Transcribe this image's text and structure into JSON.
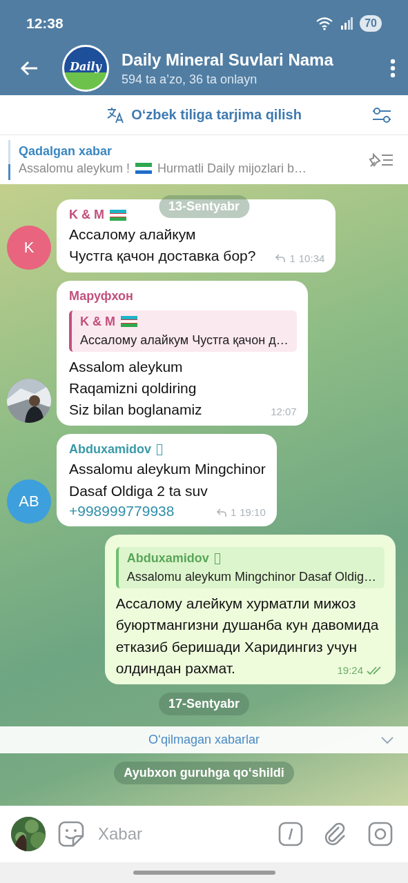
{
  "status_bar": {
    "time": "12:38",
    "battery": "70"
  },
  "header": {
    "title": "Daily Mineral Suvlari Nama",
    "subtitle": "594 ta a’zo, 36 ta onlayn",
    "logo_text": "Daily"
  },
  "translate_bar": {
    "label": "O‘zbek tiliga tarjima qilish"
  },
  "pinned": {
    "title": "Qadalgan xabar",
    "text_before": "Assalomu aleykum !",
    "text_after": "Hurmatli Daily mijozlari b…"
  },
  "floating_date": "13-Sentyabr",
  "chat": [
    {
      "kind": "incoming",
      "avatar": {
        "kind": "initials",
        "text": "K",
        "color": "#e8647f"
      },
      "sender": "K & M",
      "color": "#c2507c",
      "badge": {
        "kind": "flag"
      },
      "lines": [
        "Ассалому алайкум",
        "Чустга қачон доставка бор?"
      ],
      "replies": "1",
      "time": "10:34"
    },
    {
      "kind": "incoming",
      "avatar": {
        "kind": "picture"
      },
      "sender": "Маруфхон",
      "color": "#c2507c",
      "reply": {
        "sender": "K & M",
        "badge": {
          "kind": "flag"
        },
        "text": "Ассалому алайкум  Чустга қачон д…"
      },
      "lines": [
        "Assalom aleykum",
        "Raqamizni qoldiring",
        "Siz bilan boglanamiz"
      ],
      "time": "12:07"
    },
    {
      "kind": "incoming",
      "avatar": {
        "kind": "initials",
        "text": "AB",
        "color": "#3d9fdc"
      },
      "sender": "Abduxamidov",
      "color": "#3a9aa8",
      "badge": {
        "kind": "glyph"
      },
      "lines": [
        "Assalomu aleykum Mingchinor",
        "Dasaf Oldiga 2 ta suv"
      ],
      "link": "+998999779938",
      "replies": "1",
      "time": "19:10"
    },
    {
      "kind": "outgoing",
      "reply": {
        "sender": "Abduxamidov",
        "badge": {
          "kind": "glyph"
        },
        "text": "Assalomu aleykum Mingchinor Dasaf Oldig…"
      },
      "lines": [
        "Ассалому алейкум хурматли мижоз",
        "буюртмангизни душанба кун давомида",
        "етказиб беришади Харидингиз учун",
        "олдиндан рахмат."
      ],
      "time": "19:24",
      "read": true
    },
    {
      "kind": "date",
      "text": "17-Sentyabr"
    },
    {
      "kind": "unread",
      "text": "O‘qilmagan xabarlar"
    },
    {
      "kind": "service",
      "text": "Ayubxon guruhga qo‘shildi"
    }
  ],
  "composer": {
    "placeholder": "Xabar"
  }
}
